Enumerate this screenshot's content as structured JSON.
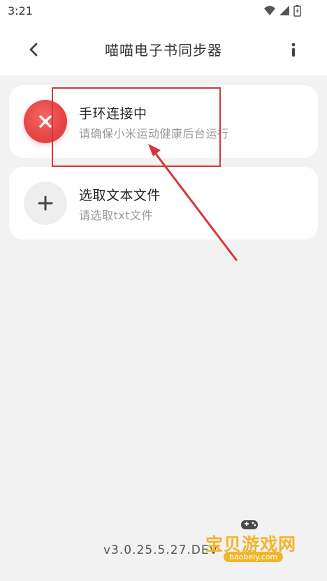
{
  "status_bar": {
    "time": "3:21"
  },
  "app_bar": {
    "title": "喵喵电子书同步器"
  },
  "cards": [
    {
      "title": "手环连接中",
      "subtitle": "请确保小米运动健康后台运行",
      "icon": "close-icon",
      "icon_color": "#e84747"
    },
    {
      "title": "选取文本文件",
      "subtitle": "请选取txt文件",
      "icon": "plus-icon"
    }
  ],
  "footer": {
    "version": "v3.0.25.5.27.DEV"
  },
  "watermark": {
    "title": "宝贝游戏网",
    "url": "baobeiy.com"
  },
  "colors": {
    "background": "#f2f2f2",
    "card": "#ffffff",
    "annotation": "#d8363a",
    "error": "#e84747",
    "watermark": "#f0b52a"
  }
}
